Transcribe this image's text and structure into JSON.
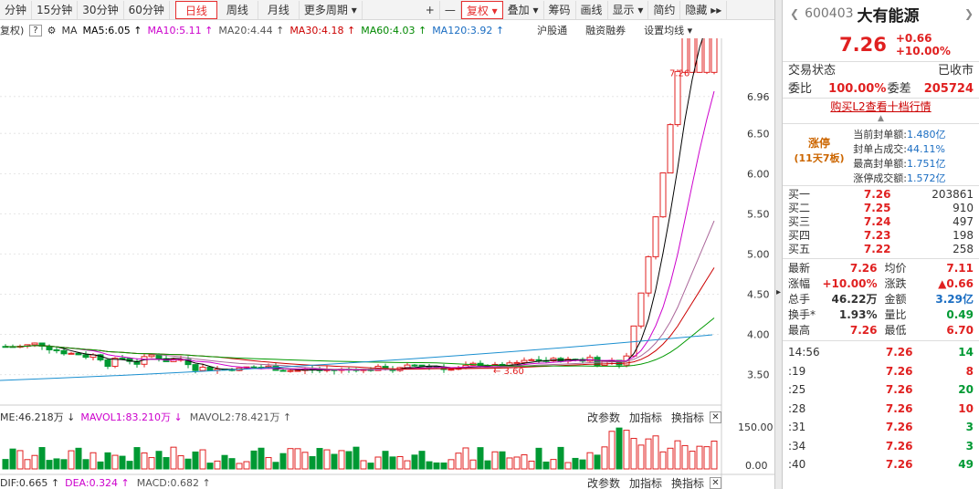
{
  "toolbar": {
    "items": [
      "分钟",
      "15分钟",
      "30分钟",
      "60分钟",
      "日线",
      "周线",
      "月线",
      "更多周期 ▾"
    ],
    "active": "日线",
    "right_items": [
      "+",
      "—",
      "复权 ▾",
      "叠加 ▾",
      "筹码",
      "画线",
      "显示 ▾",
      "简约",
      "隐藏 ▸▸"
    ]
  },
  "indicators": {
    "fq": "复权)",
    "q": "?",
    "ma": "MA",
    "ma5": "MA5:6.05 ↑",
    "ma10": "MA10:5.11 ↑",
    "ma20": "MA20:4.44 ↑",
    "ma30": "MA30:4.18 ↑",
    "ma60": "MA60:4.03 ↑",
    "ma120": "MA120:3.92 ↑",
    "links": [
      "沪股通",
      "融资融券",
      "设置均线 ▾"
    ]
  },
  "price_axis": [
    "6.96",
    "6.50",
    "6.00",
    "5.50",
    "5.00",
    "4.50",
    "4.00",
    "3.50"
  ],
  "price_annotations": {
    "high": "7.26",
    "low": "3.60"
  },
  "volume_panel": {
    "legend_vol": "ME:46.218万 ↓",
    "legend_mavol1": "MAVOL1:83.210万 ↓",
    "legend_mavol2": "MAVOL2:78.421万 ↑",
    "buttons": [
      "改参数",
      "加指标",
      "换指标"
    ],
    "axis": [
      "150.00",
      "0.00"
    ]
  },
  "macd_panel": {
    "legend_dif": "DIF:0.665 ↑",
    "legend_dea": "DEA:0.324 ↑",
    "legend_macd": "MACD:0.682 ↑",
    "buttons": [
      "改参数",
      "加指标",
      "换指标"
    ]
  },
  "colors": {
    "up": "#e02020",
    "down": "#009933",
    "ma5": "#000000",
    "ma10": "#cc00cc",
    "ma20": "#aa6699",
    "ma30": "#cc0000",
    "ma60": "#009900",
    "ma120": "#1a8fd0"
  },
  "stock": {
    "code": "600403",
    "name": "大有能源",
    "price": "7.26",
    "change": "+0.66",
    "pct": "+10.00%",
    "status_label": "交易状态",
    "status": "已收市",
    "wb_label": "委比",
    "wb": "100.00%",
    "wc_label": "委差",
    "wc": "205724",
    "l2_link": "购买L2查看十档行情"
  },
  "limit_up": {
    "title": "涨停",
    "sub": "(11天7板)",
    "rows": [
      {
        "label": "当前封单额:",
        "value": "1.480亿"
      },
      {
        "label": "封单占成交:",
        "value": "44.11%"
      },
      {
        "label": "最高封单额:",
        "value": "1.751亿"
      },
      {
        "label": "涨停成交额:",
        "value": "1.572亿"
      }
    ]
  },
  "order_book": [
    {
      "label": "买一",
      "price": "7.26",
      "vol": "203861"
    },
    {
      "label": "买二",
      "price": "7.25",
      "vol": "910"
    },
    {
      "label": "买三",
      "price": "7.24",
      "vol": "497"
    },
    {
      "label": "买四",
      "price": "7.23",
      "vol": "198"
    },
    {
      "label": "买五",
      "price": "7.22",
      "vol": "258"
    }
  ],
  "quote": [
    [
      {
        "l": "最新",
        "v": "7.26"
      },
      {
        "l": "均价",
        "v": "7.11"
      }
    ],
    [
      {
        "l": "涨幅",
        "v": "+10.00%"
      },
      {
        "l": "涨跌",
        "v": "▲0.66"
      }
    ],
    [
      {
        "l": "总手",
        "v": "46.22万"
      },
      {
        "l": "金额",
        "v": "3.29亿"
      }
    ],
    [
      {
        "l": "换手*",
        "v": "1.93%"
      },
      {
        "l": "量比",
        "v": "0.49"
      }
    ],
    [
      {
        "l": "最高",
        "v": "7.26"
      },
      {
        "l": "最低",
        "v": "6.70"
      }
    ]
  ],
  "ticks": [
    {
      "t": "14:56",
      "p": "7.26",
      "v": "14"
    },
    {
      "t": ":19",
      "p": "7.26",
      "v": "8"
    },
    {
      "t": ":25",
      "p": "7.26",
      "v": "20"
    },
    {
      "t": ":28",
      "p": "7.26",
      "v": "10"
    },
    {
      "t": ":31",
      "p": "7.26",
      "v": "3"
    },
    {
      "t": ":34",
      "p": "7.26",
      "v": "3"
    },
    {
      "t": ":40",
      "p": "7.26",
      "v": "49"
    }
  ]
}
